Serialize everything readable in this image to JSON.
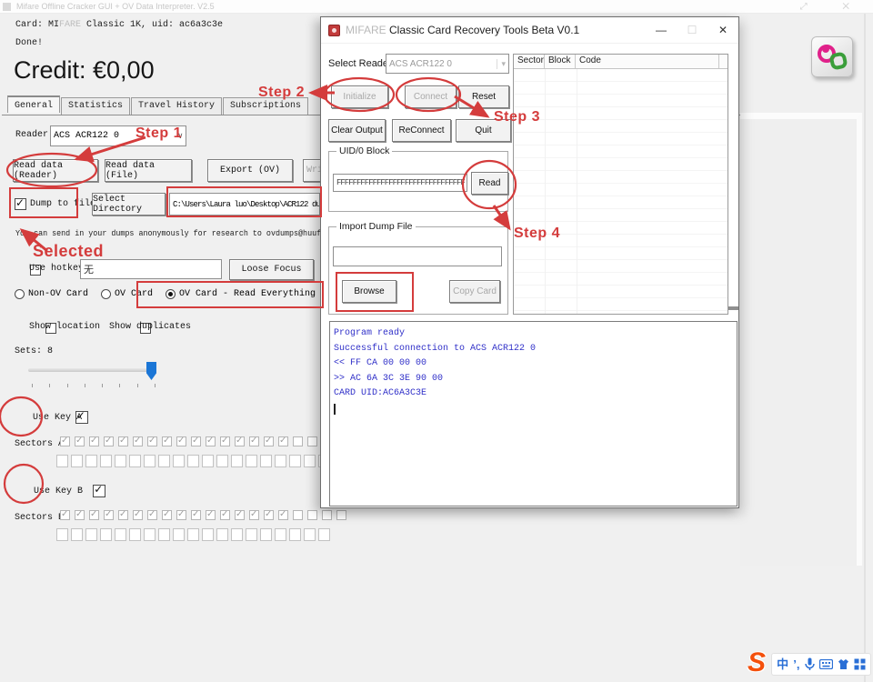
{
  "bg_window": {
    "title": "Mifare Offline Cracker GUI + OV Data Interpreter. V2.5",
    "card_prefix": "Card: MI",
    "card_info": "Classic 1K, uid: ac6a3c3e",
    "status": "Done!",
    "credit": "Credit: €0,00",
    "tabs": [
      {
        "label": "General",
        "active": true
      },
      {
        "label": "Statistics",
        "active": false
      },
      {
        "label": "Travel History",
        "active": false
      },
      {
        "label": "Subscriptions",
        "active": false
      }
    ],
    "reader_label": "Reader:",
    "reader_value": "ACS ACR122 0",
    "buttons": {
      "read_reader": "Read data (Reader)",
      "read_file": "Read data (File)",
      "export_ov": "Export (OV)",
      "write_clipped": "Wri"
    },
    "dump_label": "Dump to file",
    "select_directory": "Select Directory",
    "dump_path": "C:\\Users\\Laura luo\\Desktop\\ACR122 du",
    "info_text": "You can send in your dumps anonymously for research to ovdumps@huuf.info",
    "hotkey_label": "Use hotkey",
    "hotkey_value": "无",
    "loose_focus": "Loose Focus",
    "card_modes": [
      {
        "label": "Non-OV Card",
        "selected": false
      },
      {
        "label": "OV Card",
        "selected": false
      },
      {
        "label": "OV Card - Read Everything",
        "selected": true
      }
    ],
    "show_location": "Show location",
    "show_duplicates": "Show duplicates",
    "sets_label": "Sets: 8",
    "use_key_a": "Use Key A",
    "sectors_a_label": "Sectors A:",
    "use_key_b": "Use Key B",
    "sectors_b_label": "Sectors B:",
    "sector_rows": {
      "a_row1": {
        "checked": 16,
        "unchecked": 3
      },
      "a_row2": {
        "checked": 0,
        "unchecked": 19
      },
      "b_row1": {
        "checked": 16,
        "unchecked": 4
      },
      "b_row2": {
        "checked": 0,
        "unchecked": 19
      }
    }
  },
  "dialog": {
    "title_faded": "MIFARE",
    "title": " Classic Card Recovery Tools Beta V0.1",
    "minimize": "—",
    "maximize": "☐",
    "close": "✕",
    "select_reader_label": "Select Reader",
    "reader_value": "ACS ACR122 0",
    "buttons": {
      "initialize": "Initialize",
      "connect": "Connect",
      "reset": "Reset",
      "clear_output": "Clear Output",
      "reconnect": "ReConnect",
      "quit": "Quit",
      "read": "Read",
      "browse": "Browse",
      "copy_card": "Copy Card"
    },
    "uid_group_label": "UID/0 Block",
    "uid_value": "FFFFFFFFFFFFFFFFFFFFFFFFFFFFFFFF",
    "import_group_label": "Import Dump File",
    "import_value": "",
    "table_headers": [
      "Sector",
      "Block",
      "Code"
    ],
    "console_lines": [
      "Program ready",
      "Successful connection to ACS ACR122 0",
      "<< FF CA 00 00 00",
      ">> AC 6A 3C 3E 90 00",
      "CARD UID:AC6A3C3E"
    ]
  },
  "annotations": {
    "step1": "Step 1",
    "step2": "Step 2",
    "step3": "Step 3",
    "step4": "Step 4",
    "selected": "Selected",
    "color": "#d43c3c"
  },
  "taskbar": {
    "sogou_logo": "S",
    "lang_icon": "中",
    "punct_icon": "’,"
  },
  "colors": {
    "annotation_red": "#d43c3c",
    "console_blue": "#2f2fc8",
    "slider_blue": "#1b76d6",
    "background": "#f0f0f0"
  }
}
